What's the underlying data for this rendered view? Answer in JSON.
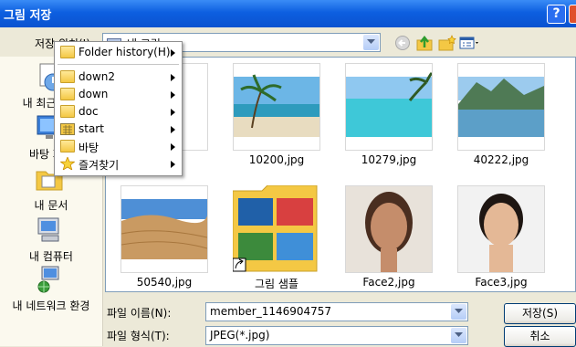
{
  "window": {
    "title": "그림 저장",
    "help_label": "?"
  },
  "save_in": {
    "label": "저장 위치(I):",
    "location": "내 그림"
  },
  "toolbar": {
    "icons": [
      "back-icon",
      "up-folder-icon",
      "new-folder-icon",
      "view-menu-icon"
    ]
  },
  "places": [
    {
      "label": "내 최근 문서",
      "icon": "recent-documents-icon"
    },
    {
      "label": "바탕 화면",
      "icon": "desktop-icon"
    },
    {
      "label": "내 문서",
      "icon": "my-documents-icon"
    },
    {
      "label": "내 컴퓨터",
      "icon": "my-computer-icon"
    },
    {
      "label": "내 네트워크 환경",
      "icon": "network-icon"
    }
  ],
  "files": [
    {
      "name": "10200,jpg",
      "kind": "beach-palm-photo"
    },
    {
      "name": "10279,jpg",
      "kind": "tropical-lagoon-photo"
    },
    {
      "name": "40222,jpg",
      "kind": "mountain-lake-photo"
    },
    {
      "name": "50540,jpg",
      "kind": "desert-dunes-photo"
    },
    {
      "name": "그림 샘플",
      "kind": "folder-shortcut"
    },
    {
      "name": "Face2,jpg",
      "kind": "portrait-photo"
    },
    {
      "name": "Face3,jpg",
      "kind": "portrait-photo"
    }
  ],
  "filename": {
    "label": "파일 이름(N):",
    "value": "member_1146904757"
  },
  "filetype": {
    "label": "파일 형식(T):",
    "value": "JPEG(*.jpg)"
  },
  "buttons": {
    "save": "저장(S)",
    "cancel": "취소"
  },
  "folder_menu": {
    "header": "Folder history(H)",
    "items": [
      "down2",
      "down",
      "doc",
      "start",
      "바탕",
      "즐겨찾기"
    ]
  },
  "colors": {
    "title_bar": "#0a52d0",
    "dialog_bg": "#ece9d8",
    "places_bg": "#fbf9ee",
    "folder": "#f4c844"
  }
}
